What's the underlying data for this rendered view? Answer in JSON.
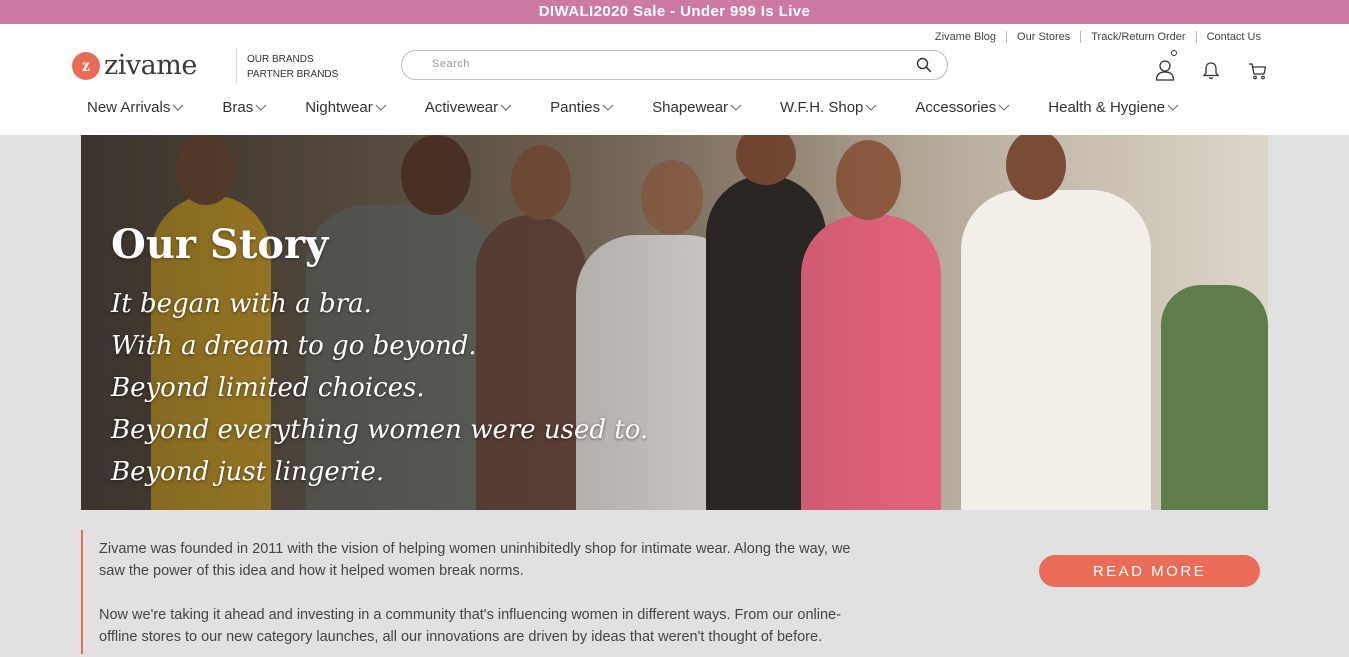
{
  "promo": {
    "text": "DIWALI2020 Sale - Under 999 Is Live"
  },
  "util_links": [
    "Zivame Blog",
    "Our Stores",
    "Track/Return Order",
    "Contact Us"
  ],
  "logo": {
    "mark": "z",
    "text": "zivame"
  },
  "brands": {
    "our": "OUR BRANDS",
    "partner": "PARTNER BRANDS"
  },
  "search": {
    "placeholder": "Search"
  },
  "nav": [
    "New Arrivals",
    "Bras",
    "Nightwear",
    "Activewear",
    "Panties",
    "Shapewear",
    "W.F.H. Shop",
    "Accessories",
    "Health & Hygiene"
  ],
  "hero": {
    "title": "Our Story",
    "lines": [
      "It began with a bra.",
      "With a dream to go beyond.",
      "Beyond limited choices.",
      "Beyond everything women were used to.",
      "Beyond just lingerie."
    ]
  },
  "story": {
    "p1": "Zivame was founded in 2011 with the vision of helping women uninhibitedly shop for intimate wear. Along the way, we saw the power of this idea and how it helped women break norms.",
    "p2": "Now we're taking it ahead and investing in a community that's influencing women in different ways. From our online-offline stores to our new category launches, all our innovations are driven by ideas that weren't thought of before."
  },
  "read_more": "READ MORE",
  "colors": {
    "promo": "#cd7aa3",
    "accent": "#ea6b58",
    "page_bg": "#e1e1e1"
  },
  "icons": [
    "search-icon",
    "user-icon",
    "bell-icon",
    "cart-icon",
    "chevron-down-icon"
  ]
}
